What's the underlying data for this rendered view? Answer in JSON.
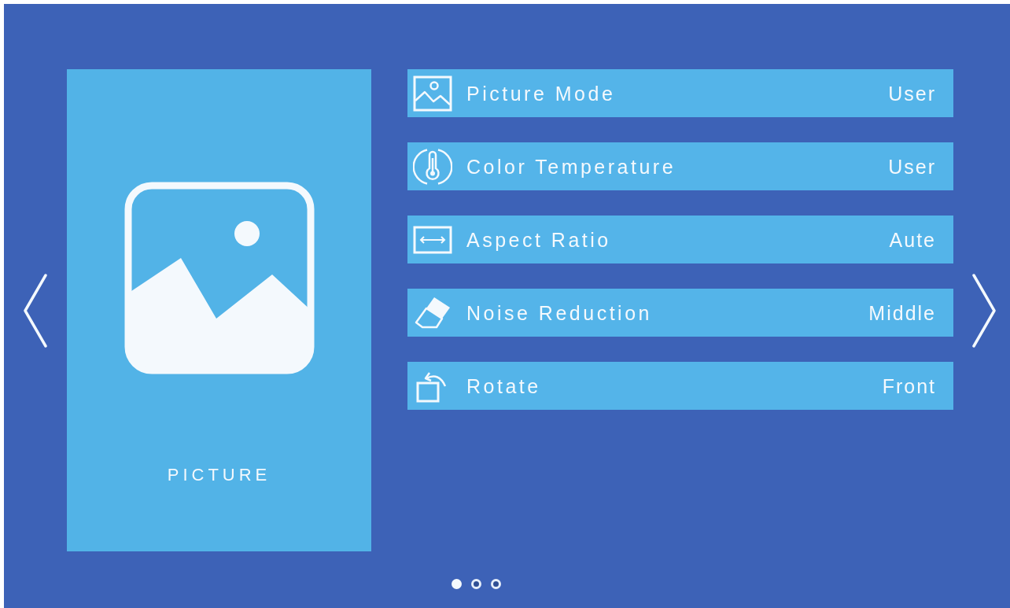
{
  "category_card": {
    "title": "PICTURE"
  },
  "settings": [
    {
      "label": "Picture Mode",
      "value": "User"
    },
    {
      "label": "Color Temperature",
      "value": "User"
    },
    {
      "label": "Aspect Ratio",
      "value": "Aute"
    },
    {
      "label": "Noise Reduction",
      "value": "Middle"
    },
    {
      "label": "Rotate",
      "value": "Front"
    }
  ],
  "pager": [
    {
      "selected": true
    },
    {
      "selected": false
    },
    {
      "selected": false
    }
  ]
}
